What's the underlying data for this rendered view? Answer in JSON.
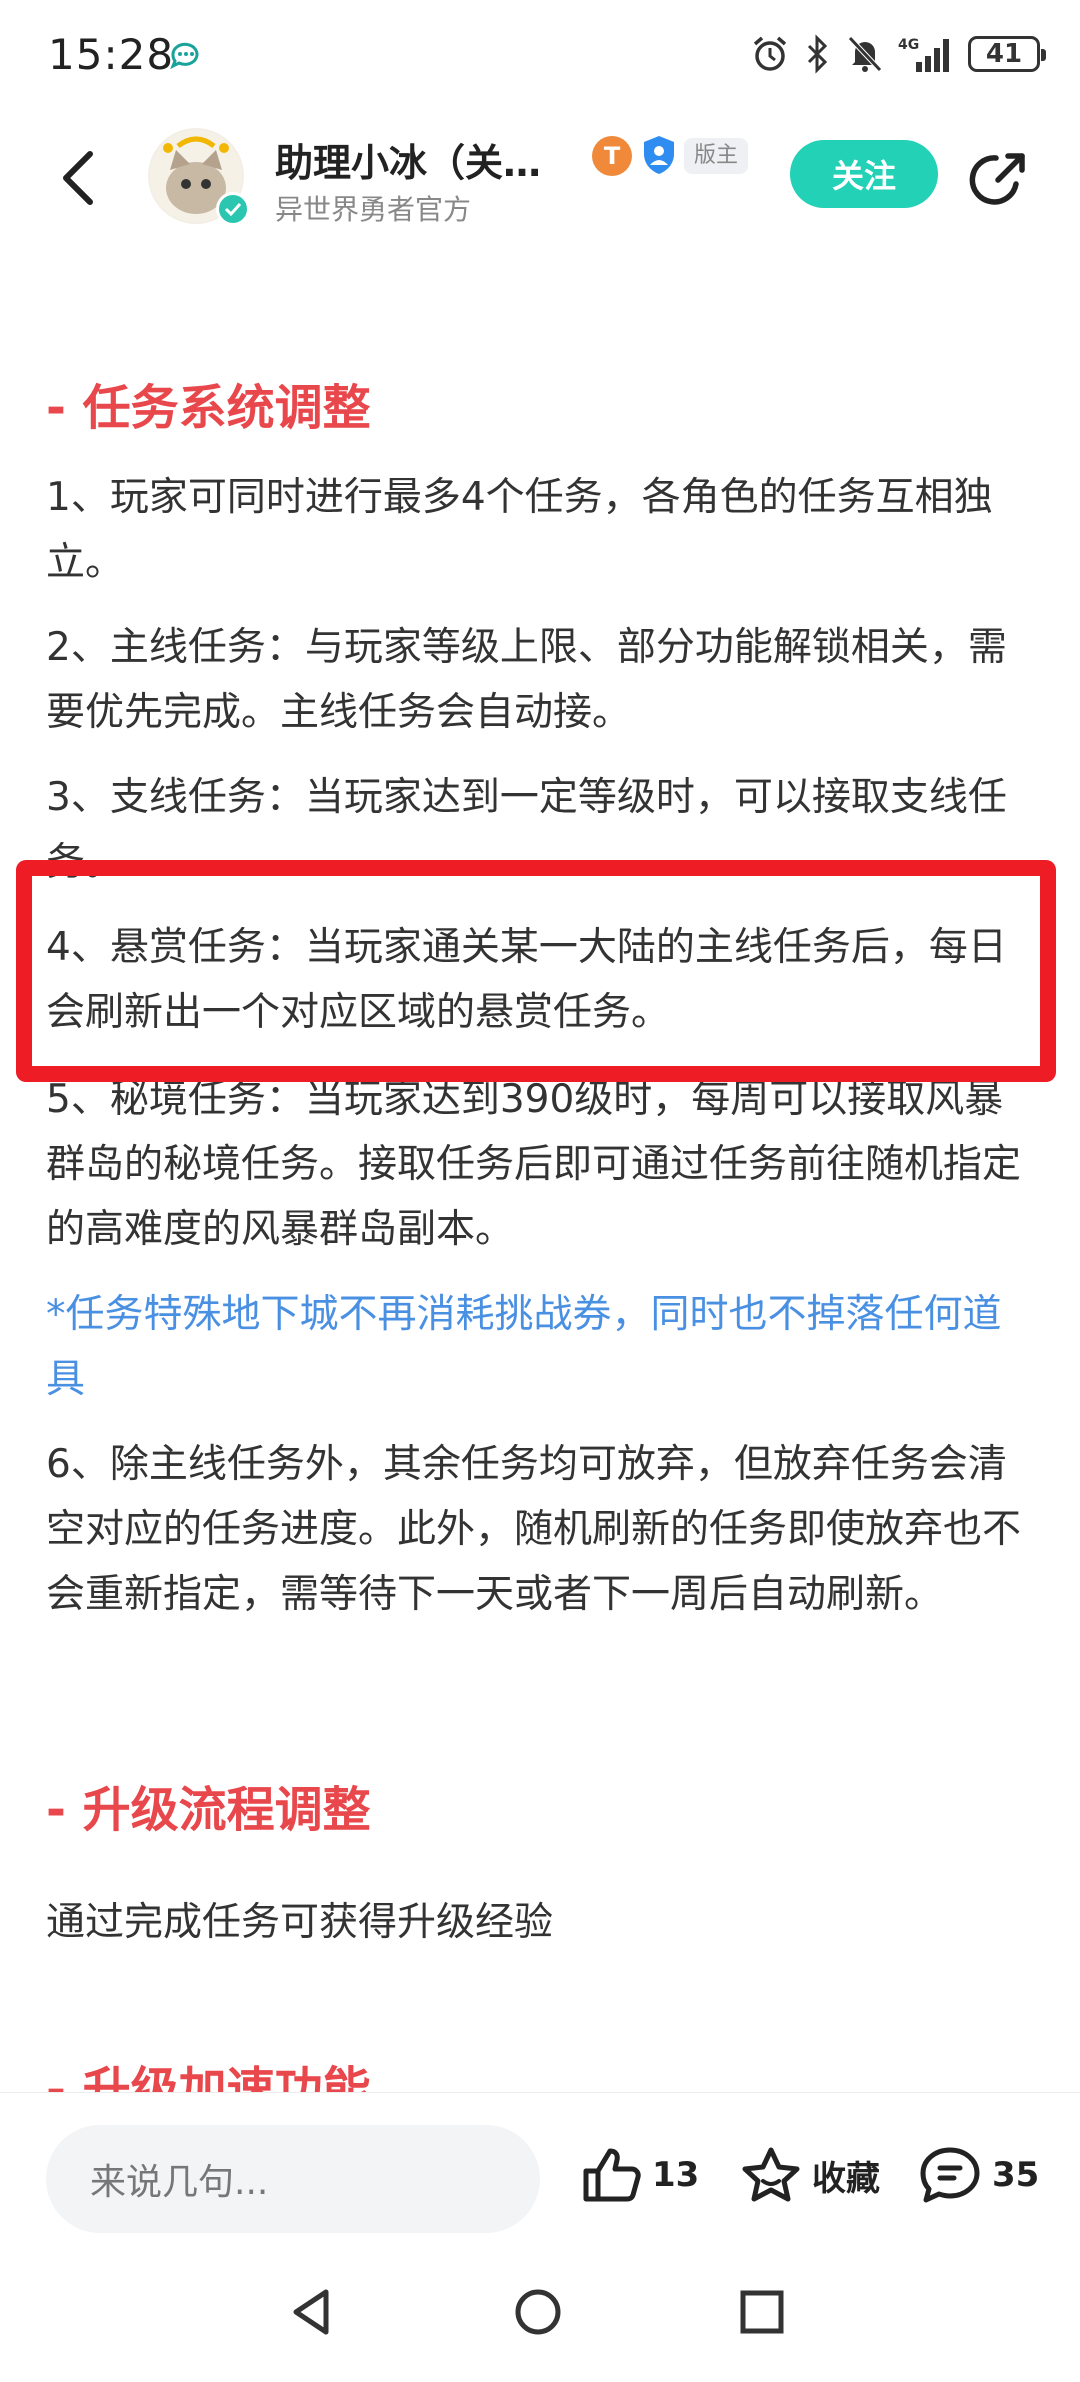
{
  "status_bar": {
    "time": "15:28",
    "battery": "41",
    "network": "4G"
  },
  "header": {
    "user_name": "助理小冰（关…",
    "user_sub": "异世界勇者官方",
    "badge_t": "T",
    "badge_mod": "版主",
    "follow_label": "关注"
  },
  "article": {
    "section1_title": "- 任务系统调整",
    "p1": "1、玩家可同时进行最多4个任务，各角色的任务互相独立。",
    "p2": "2、主线任务：与玩家等级上限、部分功能解锁相关，需要优先完成。主线任务会自动接。",
    "p3": "3、支线任务：当玩家达到一定等级时，可以接取支线任务。",
    "p4": "4、悬赏任务：当玩家通关某一大陆的主线任务后，每日会刷新出一个对应区域的悬赏任务。",
    "p5": "5、秘境任务：当玩家达到390级时，每周可以接取风暴群岛的秘境任务。接取任务后即可通过任务前往随机指定的高难度的风暴群岛副本。",
    "note": "*任务特殊地下城不再消耗挑战券，同时也不掉落任何道具",
    "p6": "6、除主线任务外，其余任务均可放弃，但放弃任务会清空对应的任务进度。此外，随机刷新的任务即使放弃也不会重新指定，需等待下一天或者下一周后自动刷新。",
    "section2_title": "- 升级流程调整",
    "p7": "通过完成任务可获得升级经验",
    "section3_title": "- 升级加速功能"
  },
  "bottom_bar": {
    "comment_placeholder": "来说几句...",
    "like_count": "13",
    "favorite_label": "收藏",
    "comment_count": "35"
  },
  "colors": {
    "accent_teal": "#22d1b6",
    "section_red": "#e8474c",
    "note_blue": "#4a90e2",
    "highlight_red": "#ee1c25"
  }
}
